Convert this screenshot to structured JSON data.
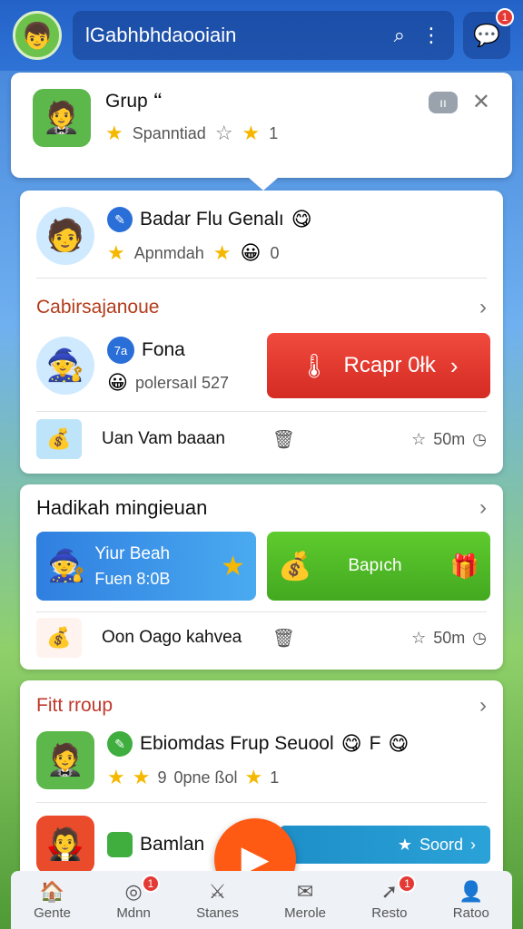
{
  "topbar": {
    "avatar_icon": "avatar-icon",
    "title": "lGabhbhdaooiain",
    "search_icon": "⌕",
    "more_icon": "⋮",
    "chat_icon": "💬",
    "chat_badge": "1"
  },
  "popup": {
    "avatar_icon": "🤵",
    "name": "Grup 🙶",
    "stars_count": "1",
    "label": "Spanntiad",
    "pill": "ıı",
    "close": "✕"
  },
  "card1": {
    "player1": {
      "avatar": "🧑",
      "name": "Badar Flu Genalı",
      "sub": "Apnmdah",
      "score": "0"
    },
    "section_title": "Cabirsajanoue",
    "player2": {
      "avatar": "🧙",
      "name": "Fona",
      "sub": "polersaıl 527",
      "level": "7a"
    },
    "red_button": "Rcapr 0łk",
    "item": {
      "name": "Uan Vam baaan",
      "time": "50m"
    }
  },
  "card2": {
    "title": "Hadikah mingieuan",
    "tile1": {
      "title": "Yiur Beah",
      "sub": "Fuen 8:0B"
    },
    "tile2": {
      "title": "Bapıch"
    },
    "item": {
      "name": "Oon Oago kahvea",
      "time": "50m"
    }
  },
  "card3": {
    "title": "Fitt rroup",
    "player1": {
      "avatar": "🤵",
      "name": "Ebiomdas Frup Seuool",
      "suffix": "F",
      "stars": "9",
      "label": "0pne ßol",
      "score": "1"
    },
    "player2": {
      "avatar": "🧛",
      "name": "Bamlan",
      "button": "Soord"
    }
  },
  "nav": [
    {
      "icon": "🏠",
      "label": "Gente",
      "badge": ""
    },
    {
      "icon": "◎",
      "label": "Mdnn",
      "badge": "1"
    },
    {
      "icon": "⚔",
      "label": "Stanes",
      "badge": ""
    },
    {
      "icon": "✉",
      "label": "Merole",
      "badge": ""
    },
    {
      "icon": "➚",
      "label": "Resto",
      "badge": "1"
    },
    {
      "icon": "👤",
      "label": "Ratoo",
      "badge": ""
    }
  ],
  "play_icon": "▶"
}
